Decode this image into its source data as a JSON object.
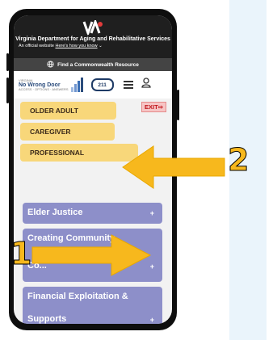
{
  "agency_banner": {
    "title": "Virginia Department for Aging and Rehabilitative Services",
    "official_text": "An official website",
    "how_know": "Here's how you know"
  },
  "find_bar": {
    "label": "Find a Commonwealth Resource"
  },
  "navbar": {
    "brand_small": "VIRGINIA",
    "brand_name": "No Wrong Door",
    "brand_tagline": "ACCESS · OPTIONS · ANSWERS",
    "badge_211": "211",
    "badge_211_sub": "Virginia"
  },
  "roles": {
    "exit_label": "EXIT",
    "items": [
      "OLDER ADULT",
      "CAREGIVER",
      "PROFESSIONAL"
    ]
  },
  "accordion": {
    "items": [
      {
        "label": "Elder Justice"
      },
      {
        "label_line1": "Creating Community",
        "label_line2": "Co..."
      },
      {
        "label_line1": "Financial Exploitation &",
        "label_line2": "Supports"
      }
    ],
    "plus": "+"
  },
  "annotations": {
    "one": "1",
    "two": "2"
  },
  "colors": {
    "accordion": "#8d8fc9",
    "role_button": "#f8d77a",
    "arrow": "#f7b81d"
  }
}
